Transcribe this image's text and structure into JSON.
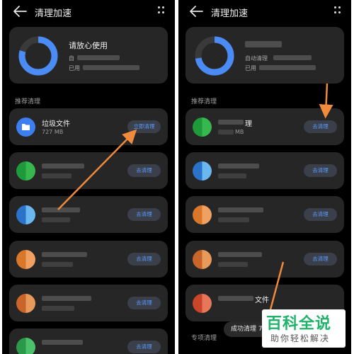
{
  "colors": {
    "accent_blue": "#4a8bf5",
    "button_text": "#5a9cff",
    "arrow": "#f08a3c",
    "watermark_green": "#1fb36a"
  },
  "left_screen": {
    "title": "清理加速",
    "summary": {
      "headline": "请放心使用",
      "line1": "自",
      "line2": "已用"
    },
    "section_label": "推荐清理",
    "items": [
      {
        "name": "垃圾文件",
        "size": "727 MB",
        "icon": "folder-icon",
        "button": "立即清理"
      },
      {
        "name": "",
        "size": "",
        "icon": "app-icon-green",
        "button": "去清理"
      },
      {
        "name": "",
        "size": "",
        "icon": "app-icon-blue",
        "button": "去清理"
      },
      {
        "name": "",
        "size": "",
        "icon": "app-icon-orange",
        "button": "去清理"
      },
      {
        "name": "",
        "size": "",
        "icon": "app-icon-orange",
        "button": "去清理"
      },
      {
        "name": "",
        "size": "",
        "icon": "app-icon-green",
        "button": "去清理"
      }
    ]
  },
  "right_screen": {
    "title": "清理加速",
    "summary": {
      "line1": "自动清理",
      "line2": "已用"
    },
    "section_label": "推荐清理",
    "items": [
      {
        "name": "理",
        "size": "MB",
        "icon": "app-icon-green",
        "button": "去清理"
      },
      {
        "name": "",
        "size": "",
        "icon": "app-icon-blue",
        "button": "去清理"
      },
      {
        "name": "",
        "size": "",
        "icon": "app-icon-orange",
        "button": "去清理"
      },
      {
        "name": "",
        "size": "",
        "icon": "app-icon-orange",
        "button": "去清理"
      },
      {
        "name": "文件",
        "size": "",
        "icon": "app-icon-red",
        "button": ""
      }
    ],
    "section_label_2": "专项清理",
    "toast": "成功清理 7"
  },
  "watermark": {
    "main": "百科全说",
    "sub": "助你轻松解决"
  }
}
